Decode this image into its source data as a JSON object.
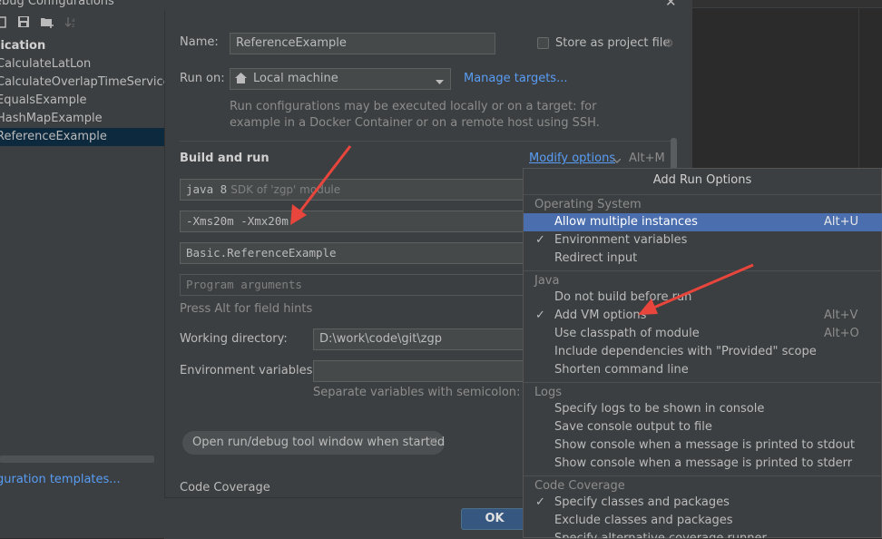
{
  "dialog": {
    "title": "ebug Configurations",
    "close_glyph": "✕"
  },
  "left": {
    "toolbar": [
      "save-icon",
      "copy-icon",
      "folder-add-icon",
      "sort-icon"
    ],
    "group": "lication",
    "items": [
      "CalculateLatLon",
      "CalculateOverlapTimeServiceImp",
      "EqualsExample",
      "HashMapExample",
      "ReferenceExample"
    ],
    "selected": "ReferenceExample",
    "templates_link": "guration templates..."
  },
  "form": {
    "name_label": "Name:",
    "name_value": "ReferenceExample",
    "store_label": "Store as project file",
    "run_on_label": "Run on:",
    "run_on_value": "Local machine",
    "manage_targets": "Manage targets...",
    "run_on_help_1": "Run configurations may be executed locally or on a target: for",
    "run_on_help_2": "example in a Docker Container or on a remote host using SSH.",
    "build_run": "Build and run",
    "modify_options": "Modify options",
    "modify_shortcut": "Alt+M",
    "sdk_value": "java 8",
    "sdk_hint": "SDK of 'zgp' module",
    "vm_options": "-Xms20m -Xmx20m",
    "main_class": "Basic.ReferenceExample",
    "program_args_placeholder": "Program arguments",
    "press_alt": "Press Alt for field hints",
    "workdir_label": "Working directory:",
    "workdir_value": "D:\\work\\code\\git\\zgp",
    "env_label": "Environment variables:",
    "env_help": "Separate variables with semicolon: VAR",
    "chip_label": "Open run/debug tool window when started",
    "chip_close": "×",
    "code_coverage": "Code Coverage",
    "ok": "OK"
  },
  "popup": {
    "title": "Add Run Options",
    "sections": [
      {
        "name": "Operating System",
        "options": [
          {
            "label": "Allow multiple instances",
            "shortcut": "Alt+U",
            "checked": false,
            "highlighted": true
          },
          {
            "label": "Environment variables",
            "shortcut": "",
            "checked": true
          },
          {
            "label": "Redirect input",
            "shortcut": "",
            "checked": false
          }
        ]
      },
      {
        "name": "Java",
        "options": [
          {
            "label": "Do not build before run",
            "shortcut": "",
            "checked": false
          },
          {
            "label": "Add VM options",
            "shortcut": "Alt+V",
            "checked": true
          },
          {
            "label": "Use classpath of module",
            "shortcut": "Alt+O",
            "checked": false
          },
          {
            "label": "Include dependencies with \"Provided\" scope",
            "shortcut": "",
            "checked": false
          },
          {
            "label": "Shorten command line",
            "shortcut": "",
            "checked": false
          }
        ]
      },
      {
        "name": "Logs",
        "options": [
          {
            "label": "Specify logs to be shown in console",
            "shortcut": "",
            "checked": false
          },
          {
            "label": "Save console output to file",
            "shortcut": "",
            "checked": false
          },
          {
            "label": "Show console when a message is printed to stdout",
            "shortcut": "",
            "checked": false
          },
          {
            "label": "Show console when a message is printed to stderr",
            "shortcut": "",
            "checked": false
          }
        ]
      },
      {
        "name": "Code Coverage",
        "options": [
          {
            "label": "Specify classes and packages",
            "shortcut": "",
            "checked": true
          },
          {
            "label": "Exclude classes and packages",
            "shortcut": "",
            "checked": false
          },
          {
            "label": "Specify alternative coverage runner",
            "shortcut": "",
            "checked": false
          }
        ]
      }
    ],
    "check_glyph": "✓"
  },
  "colors": {
    "accent": "#589df6",
    "highlight": "#4b6eaf",
    "annotation_arrow": "#e8453c"
  }
}
